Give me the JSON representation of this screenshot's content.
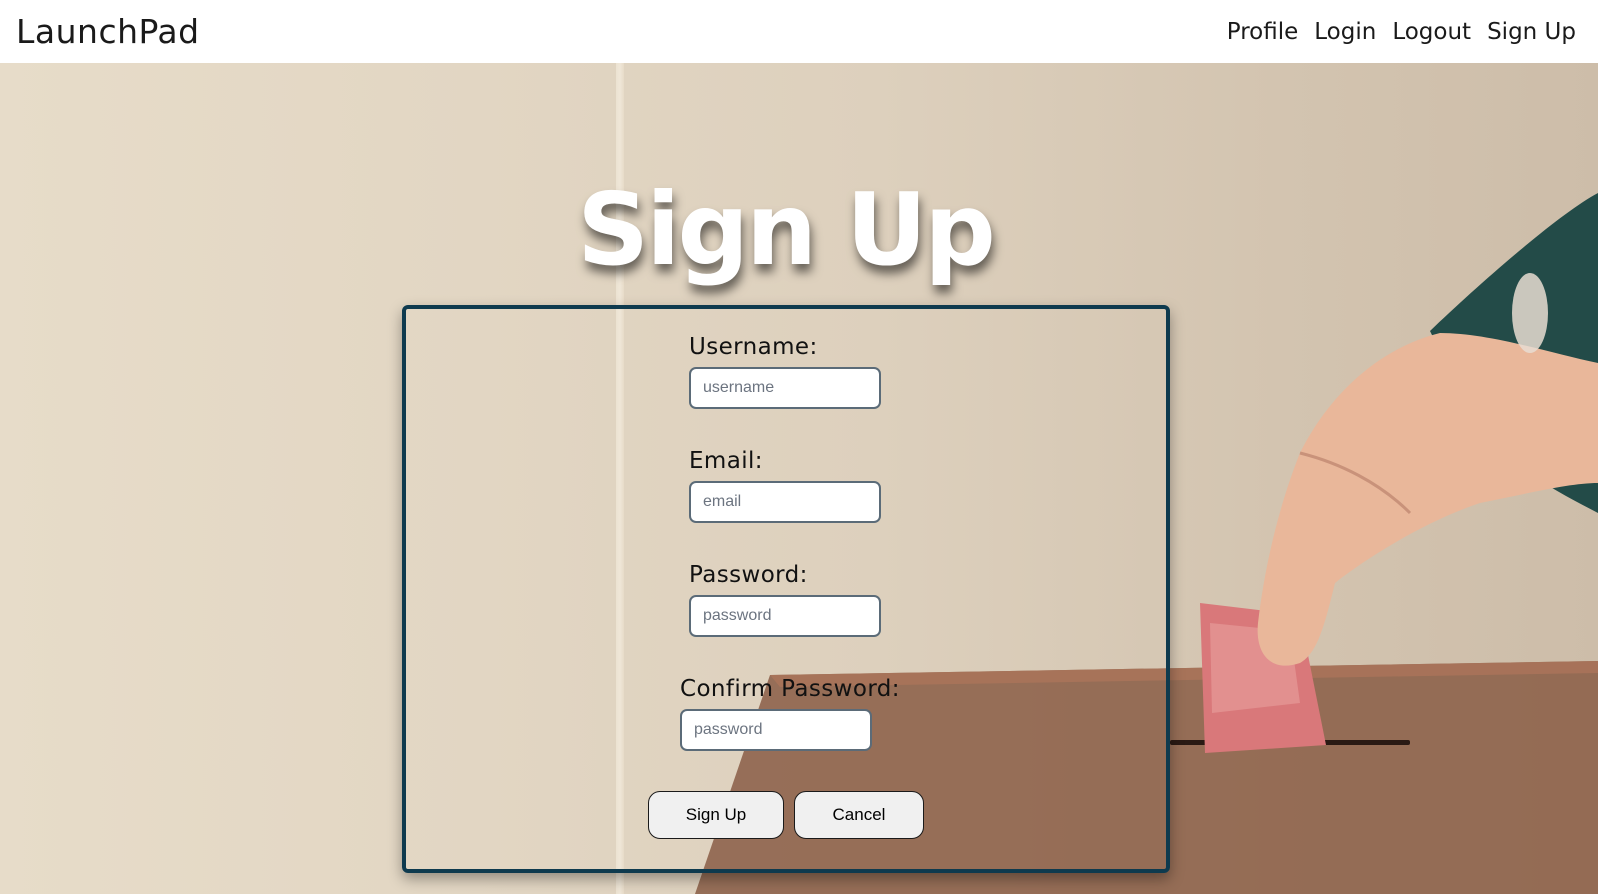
{
  "navbar": {
    "brand": "LaunchPad",
    "links": [
      "Profile",
      "Login",
      "Logout",
      "Sign Up"
    ]
  },
  "page": {
    "heading": "Sign Up"
  },
  "form": {
    "username": {
      "label": "Username:",
      "placeholder": "username"
    },
    "email": {
      "label": "Email:",
      "placeholder": "email"
    },
    "password": {
      "label": "Password:",
      "placeholder": "password"
    },
    "confirm_password": {
      "label": "Confirm Password:",
      "placeholder": "password"
    },
    "submit_label": "Sign Up",
    "cancel_label": "Cancel"
  },
  "colors": {
    "panel_border": "#0e3a4e",
    "navbar_bg": "#ffffff",
    "heading_text": "#ffffff"
  }
}
